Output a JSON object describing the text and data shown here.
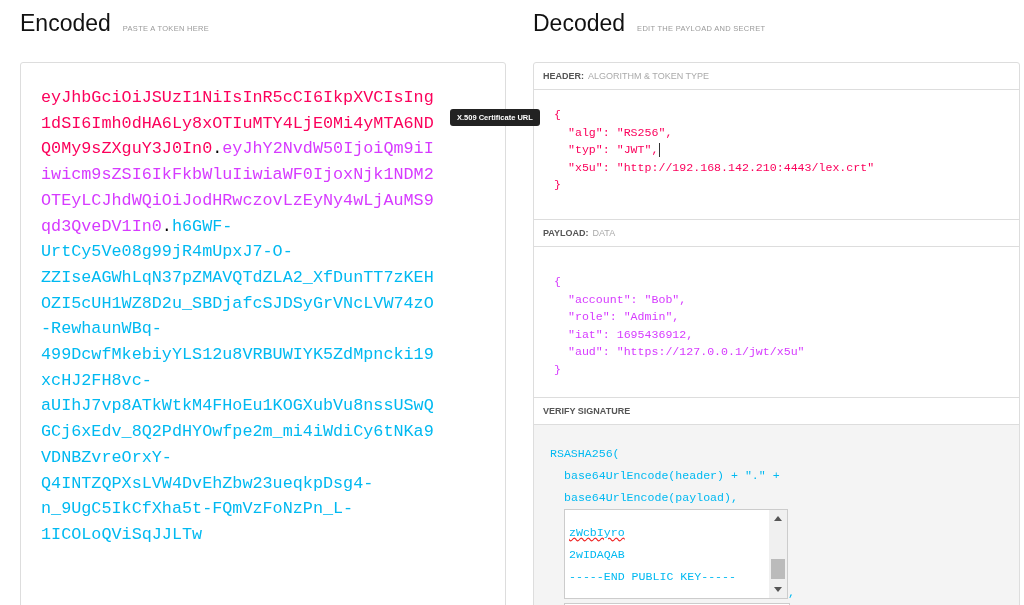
{
  "encoded": {
    "title": "Encoded",
    "subtitle": "PASTE A TOKEN HERE",
    "token_lines": [
      [
        {
          "kind": "header",
          "text": "eyJhbGciOiJSUzI1NiIsInR5cCI6IkpXVCIsIng"
        }
      ],
      [
        {
          "kind": "header",
          "text": "1dSI6Imh0dHA6Ly8xOTIuMTY4LjE0Mi4yMTA6ND"
        }
      ],
      [
        {
          "kind": "header",
          "text": "Q0My9sZXguY3J0In0"
        },
        {
          "kind": "dot",
          "text": "."
        },
        {
          "kind": "payload",
          "text": "eyJhY2NvdW50IjoiQm9iI"
        }
      ],
      [
        {
          "kind": "payload",
          "text": "iwicm9sZSI6IkFkbWluIiwiaWF0IjoxNjk1NDM2"
        }
      ],
      [
        {
          "kind": "payload",
          "text": "OTEyLCJhdWQiOiJodHRwczovLzEyNy4wLjAuMS9"
        }
      ],
      [
        {
          "kind": "payload",
          "text": "qd3QveDV1In0"
        },
        {
          "kind": "dot",
          "text": "."
        },
        {
          "kind": "signature",
          "text": "h6GWF-"
        }
      ],
      [
        {
          "kind": "signature",
          "text": "UrtCy5Ve08g99jR4mUpxJ7-O-"
        }
      ],
      [
        {
          "kind": "signature",
          "text": "ZZIseAGWhLqN37pZMAVQTdZLA2_XfDunTT7zKEH"
        }
      ],
      [
        {
          "kind": "signature",
          "text": "OZI5cUH1WZ8D2u_SBDjafcSJDSyGrVNcLVW74zO"
        }
      ],
      [
        {
          "kind": "signature",
          "text": "-RewhaunWBq-"
        }
      ],
      [
        {
          "kind": "signature",
          "text": "499DcwfMkebiyYLS12u8VRBUWIYK5ZdMpncki19"
        }
      ],
      [
        {
          "kind": "signature",
          "text": "xcHJ2FH8vc-"
        }
      ],
      [
        {
          "kind": "signature",
          "text": "aUIhJ7vp8ATkWtkM4FHoEu1KOGXubVu8nssUSwQ"
        }
      ],
      [
        {
          "kind": "signature",
          "text": "GCj6xEdv_8Q2PdHYOwfpe2m_mi4iWdiCy6tNKa9"
        }
      ],
      [
        {
          "kind": "signature",
          "text": "VDNBZvreOrxY-"
        }
      ],
      [
        {
          "kind": "signature",
          "text": "Q4INTZQPXsLVW4DvEhZbw23ueqkpDsg4-"
        }
      ],
      [
        {
          "kind": "signature",
          "text": "n_9UgC5IkCfXha5t-FQmVzFoNzPn_L-"
        }
      ],
      [
        {
          "kind": "signature",
          "text": "1ICOLoQViSqJJLTw"
        }
      ]
    ],
    "tooltip": "X.509 Certificate URL"
  },
  "decoded": {
    "title": "Decoded",
    "subtitle": "EDIT THE PAYLOAD AND SECRET",
    "header": {
      "label": "HEADER:",
      "sublabel": "ALGORITHM & TOKEN TYPE",
      "open": "{",
      "close": "}",
      "entries": [
        {
          "text": "\"alg\": \"RS256\",",
          "cursor": false
        },
        {
          "text": "\"typ\": \"JWT\",",
          "cursor": true
        },
        {
          "text": "\"x5u\": \"http://192.168.142.210:4443/lex.crt\"",
          "cursor": false
        }
      ]
    },
    "payload": {
      "label": "PAYLOAD:",
      "sublabel": "DATA",
      "open": "{",
      "close": "}",
      "entries": [
        {
          "text": "\"account\": \"Bob\",",
          "cursor": false
        },
        {
          "text": "\"role\": \"Admin\",",
          "cursor": false
        },
        {
          "text": "\"iat\": 1695436912,",
          "cursor": false
        },
        {
          "text": "\"aud\": \"https://127.0.0.1/jwt/x5u\"",
          "cursor": false
        }
      ]
    },
    "verify": {
      "label": "VERIFY SIGNATURE",
      "function": "RSASHA256(",
      "args": [
        "base64UrlEncode(header) + \".\" +",
        "base64UrlEncode(payload),"
      ],
      "key_lines": [
        {
          "text": "zWcbIyro",
          "misspelled": true
        },
        {
          "text": "2wIDAQAB",
          "misspelled": false
        },
        {
          "text": "-----END PUBLIC KEY-----",
          "misspelled": false
        }
      ],
      "separator": ","
    }
  }
}
